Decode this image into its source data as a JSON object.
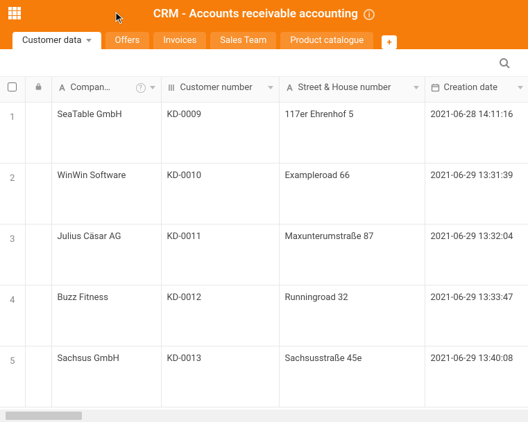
{
  "header": {
    "title": "CRM - Accounts receivable accounting"
  },
  "tabs": [
    {
      "label": "Customer data",
      "active": true
    },
    {
      "label": "Offers",
      "active": false
    },
    {
      "label": "Invoices",
      "active": false
    },
    {
      "label": "Sales Team",
      "active": false
    },
    {
      "label": "Product catalogue",
      "active": false
    }
  ],
  "columns": {
    "company": "Compan…",
    "customer_number": "Customer number",
    "street": "Street & House number",
    "creation_date": "Creation date"
  },
  "rows": [
    {
      "idx": "1",
      "company": "SeaTable GmbH",
      "cust": "KD-0009",
      "street": "117er Ehrenhof 5",
      "date": "2021-06-28 14:11:16"
    },
    {
      "idx": "2",
      "company": "WinWin Software",
      "cust": "KD-0010",
      "street": "Exampleroad 66",
      "date": "2021-06-29 13:31:39"
    },
    {
      "idx": "3",
      "company": "Julius Cäsar AG",
      "cust": "KD-0011",
      "street": "Maxunterumstraße 87",
      "date": "2021-06-29 13:32:04"
    },
    {
      "idx": "4",
      "company": "Buzz Fitness",
      "cust": "KD-0012",
      "street": "Runningroad 32",
      "date": "2021-06-29 13:33:47"
    },
    {
      "idx": "5",
      "company": "Sachsus GmbH",
      "cust": "KD-0013",
      "street": "Sachsusstraße 45e",
      "date": "2021-06-29 13:40:08"
    }
  ],
  "colors": {
    "brand": "#f77d0a"
  }
}
